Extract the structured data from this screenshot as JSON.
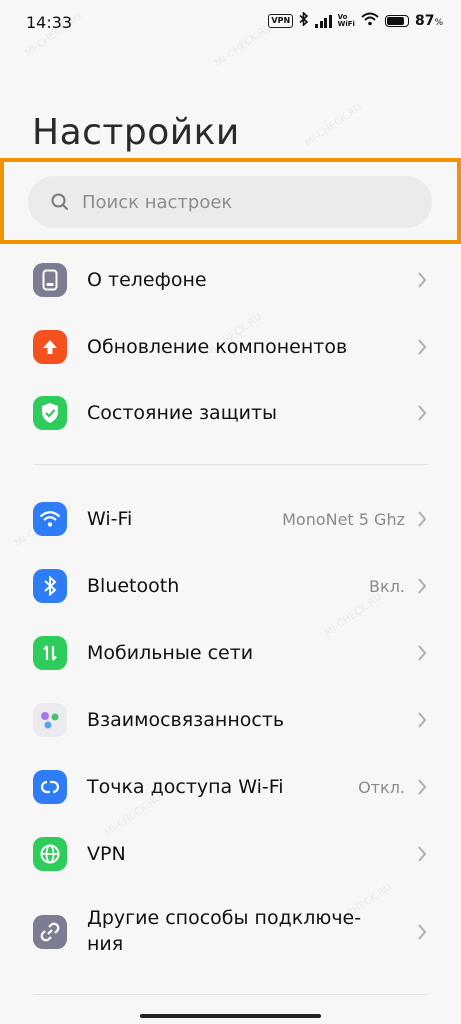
{
  "status_bar": {
    "time": "14:33",
    "vpn_badge": "VPN",
    "vowifi_top": "Vo",
    "vowifi_bottom": "WiFi",
    "battery_percent": "87",
    "battery_symbol": "%",
    "battery_level": 0.87
  },
  "page_title": "Настройки",
  "search": {
    "placeholder": "Поиск настроек",
    "highlight_color": "#f39200"
  },
  "watermark": "MI-CHECK.RU",
  "sections": [
    {
      "items": [
        {
          "label": "О телефоне",
          "icon": "phone-info-icon",
          "color": "#7c7d92",
          "value": ""
        },
        {
          "label": "Обновление компонентов",
          "icon": "arrow-up-icon",
          "color": "#f4511e",
          "value": ""
        },
        {
          "label": "Состояние защиты",
          "icon": "shield-check-icon",
          "color": "#2ecc5b",
          "value": ""
        }
      ]
    },
    {
      "items": [
        {
          "label": "Wi-Fi",
          "icon": "wifi-icon",
          "color": "#2f7df6",
          "value": "MonoNet 5 Ghz"
        },
        {
          "label": "Bluetooth",
          "icon": "bluetooth-icon",
          "color": "#2f7df6",
          "value": "Вкл."
        },
        {
          "label": "Мобильные сети",
          "icon": "mobile-data-icon",
          "color": "#2ecc5b",
          "value": ""
        },
        {
          "label": "Взаимосвязанность",
          "icon": "interconnect-icon",
          "color": "#e8e8ee",
          "value": ""
        },
        {
          "label": "Точка доступа Wi-Fi",
          "icon": "hotspot-icon",
          "color": "#2f7df6",
          "value": "Откл."
        },
        {
          "label": "VPN",
          "icon": "globe-icon",
          "color": "#2ecc5b",
          "value": ""
        },
        {
          "label_line1": "Другие способы подключе-",
          "label_line2": "ния",
          "icon": "link-icon",
          "color": "#7c7d92",
          "value": ""
        }
      ]
    }
  ]
}
